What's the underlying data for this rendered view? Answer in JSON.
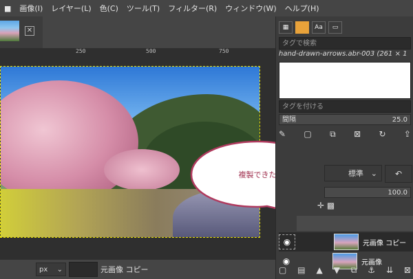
{
  "menu": [
    "画像(I)",
    "レイヤー(L)",
    "色(C)",
    "ツール(T)",
    "フィルター(R)",
    "ウィンドウ(W)",
    "ヘルプ(H)"
  ],
  "ruler": {
    "ticks": [
      "250",
      "500",
      "750"
    ]
  },
  "statusbar": {
    "unit": "px",
    "text": "元画像 コピー"
  },
  "dock": {
    "tab_label_aa": "Aa",
    "tag_search_placeholder": "タグで検索",
    "brush_name": "hand-drawn-arrows.abr-003 (261 × 1",
    "tag_give_placeholder": "タグを付ける",
    "spacing_label": "間隔",
    "spacing_value": "25.0",
    "mode_label": "標準",
    "opacity_value": "100.0",
    "layers": [
      {
        "name": "元画像 コピー"
      },
      {
        "name": "元画像"
      }
    ]
  },
  "bubble": {
    "text": "複製できた"
  }
}
